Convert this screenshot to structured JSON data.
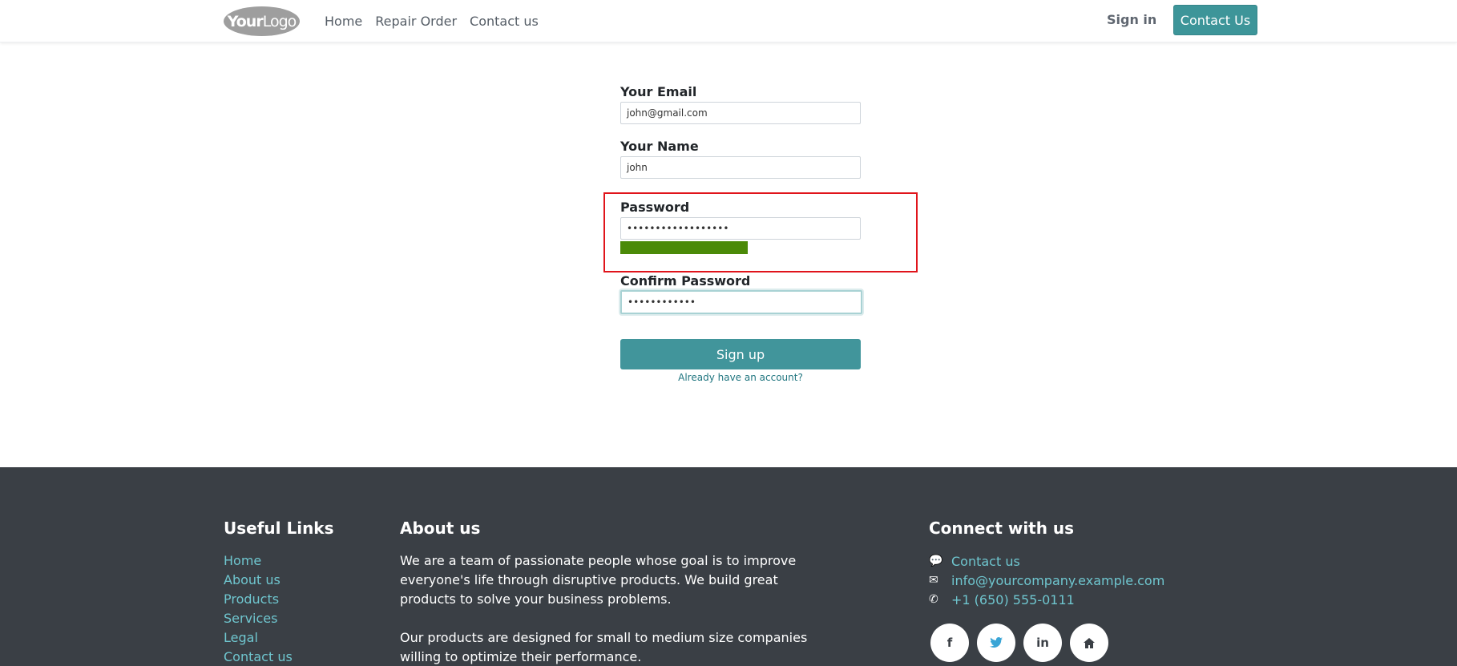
{
  "header": {
    "logo_bold": "Your",
    "logo_light": "Logo",
    "nav": [
      "Home",
      "Repair Order",
      "Contact us"
    ],
    "sign_in": "Sign in",
    "contact_button": "Contact Us"
  },
  "form": {
    "email_label": "Your Email",
    "email_value": "john@gmail.com",
    "name_label": "Your Name",
    "name_value": "john",
    "password_label": "Password",
    "password_value": "••••••••••••••••••",
    "password_strength": 0.53,
    "confirm_label": "Confirm Password",
    "confirm_value": "••••••••••••",
    "signup_button": "Sign up",
    "already_link": "Already have an account?"
  },
  "footer": {
    "useful_title": "Useful Links",
    "links": [
      "Home",
      "About us",
      "Products",
      "Services",
      "Legal",
      "Contact us"
    ],
    "about_title": "About us",
    "about_p1": "We are a team of passionate people whose goal is to improve everyone's life through disruptive products. We build great products to solve your business problems.",
    "about_p2": "Our products are designed for small to medium size companies willing to optimize their performance.",
    "connect_title": "Connect with us",
    "contact_link": "Contact us",
    "email": "info@yourcompany.example.com",
    "phone": "+1 (650) 555-0111",
    "social": [
      "f",
      "t",
      "in",
      "home"
    ]
  },
  "colors": {
    "accent": "#41959b",
    "strength": "#4b8a08",
    "highlight": "#e0141b",
    "footer": "#3a3f45",
    "link": "#6fc6cf"
  }
}
